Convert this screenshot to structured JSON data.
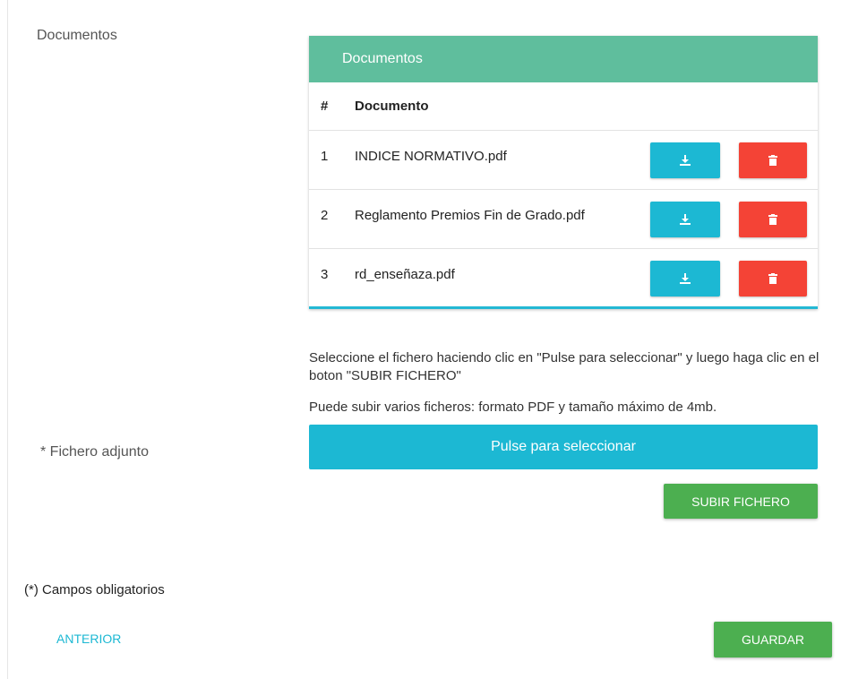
{
  "labels": {
    "documents": "Documentos",
    "file_attached": "* Fichero adjunto",
    "required_note": "(*) Campos obligatorios"
  },
  "table": {
    "title": "Documentos",
    "headers": [
      "#",
      "Documento"
    ],
    "rows": [
      {
        "num": "1",
        "name": "INDICE NORMATIVO.pdf"
      },
      {
        "num": "2",
        "name": "Reglamento Premios Fin de Grado.pdf"
      },
      {
        "num": "3",
        "name": "rd_enseñaza.pdf"
      }
    ]
  },
  "instructions": {
    "line1": "Seleccione el fichero haciendo clic en \"Pulse para seleccionar\" y luego haga clic en el boton \"SUBIR FICHERO\"",
    "line2": "Puede subir varios ficheros: formato PDF y tamaño máximo de 4mb."
  },
  "buttons": {
    "select": "Pulse para seleccionar",
    "upload": "SUBIR FICHERO",
    "previous": "ANTERIOR",
    "save": "GUARDAR"
  },
  "colors": {
    "card_header": "#5fbe9d",
    "download": "#1cb8d3",
    "delete": "#f44336",
    "success": "#4caf50",
    "link": "#1cb8d3"
  },
  "icons": {
    "download": "download-icon",
    "delete": "trash-icon"
  }
}
